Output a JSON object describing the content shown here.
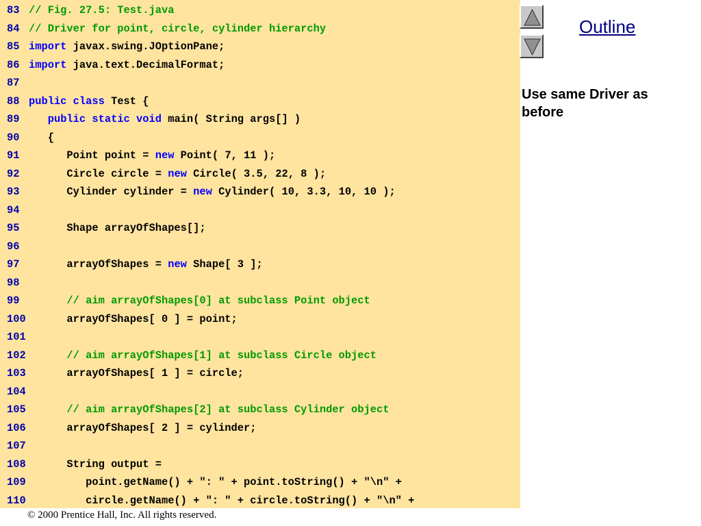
{
  "code_lines": [
    {
      "num": "83",
      "segs": [
        {
          "t": "// Fig. 27.5: Test.java",
          "k": "comment"
        }
      ]
    },
    {
      "num": "84",
      "segs": [
        {
          "t": "// Driver for point, circle, cylinder hierarchy",
          "k": "comment"
        }
      ]
    },
    {
      "num": "85",
      "segs": [
        {
          "t": "import",
          "k": "keyword"
        },
        {
          "t": " javax.swing.JOptionPane;",
          "k": "text"
        }
      ]
    },
    {
      "num": "86",
      "segs": [
        {
          "t": "import",
          "k": "keyword"
        },
        {
          "t": " java.text.DecimalFormat;",
          "k": "text"
        }
      ]
    },
    {
      "num": "87",
      "segs": []
    },
    {
      "num": "88",
      "segs": [
        {
          "t": "public class",
          "k": "keyword"
        },
        {
          "t": " Test {",
          "k": "text"
        }
      ]
    },
    {
      "num": "89",
      "segs": [
        {
          "t": "   ",
          "k": "text"
        },
        {
          "t": "public static void",
          "k": "keyword"
        },
        {
          "t": " main( String args[] )",
          "k": "text"
        }
      ]
    },
    {
      "num": "90",
      "segs": [
        {
          "t": "   {",
          "k": "text"
        }
      ]
    },
    {
      "num": "91",
      "segs": [
        {
          "t": "      Point point = ",
          "k": "text"
        },
        {
          "t": "new",
          "k": "keyword"
        },
        {
          "t": " Point( 7, 11 );",
          "k": "text"
        }
      ]
    },
    {
      "num": "92",
      "segs": [
        {
          "t": "      Circle circle = ",
          "k": "text"
        },
        {
          "t": "new",
          "k": "keyword"
        },
        {
          "t": " Circle( 3.5, 22, 8 );",
          "k": "text"
        }
      ]
    },
    {
      "num": "93",
      "segs": [
        {
          "t": "      Cylinder cylinder = ",
          "k": "text"
        },
        {
          "t": "new",
          "k": "keyword"
        },
        {
          "t": " Cylinder( 10, 3.3, 10, 10 );",
          "k": "text"
        }
      ]
    },
    {
      "num": "94",
      "segs": []
    },
    {
      "num": "95",
      "segs": [
        {
          "t": "      Shape arrayOfShapes[];",
          "k": "text"
        }
      ]
    },
    {
      "num": "96",
      "segs": []
    },
    {
      "num": "97",
      "segs": [
        {
          "t": "      arrayOfShapes = ",
          "k": "text"
        },
        {
          "t": "new",
          "k": "keyword"
        },
        {
          "t": " Shape[ 3 ];",
          "k": "text"
        }
      ]
    },
    {
      "num": "98",
      "segs": []
    },
    {
      "num": "99",
      "segs": [
        {
          "t": "      // aim arrayOfShapes[0] at subclass Point object",
          "k": "comment"
        }
      ]
    },
    {
      "num": "100",
      "segs": [
        {
          "t": "      arrayOfShapes[ 0 ] = point;",
          "k": "text"
        }
      ]
    },
    {
      "num": "101",
      "segs": []
    },
    {
      "num": "102",
      "segs": [
        {
          "t": "      // aim arrayOfShapes[1] at subclass Circle object",
          "k": "comment"
        }
      ]
    },
    {
      "num": "103",
      "segs": [
        {
          "t": "      arrayOfShapes[ 1 ] = circle;",
          "k": "text"
        }
      ]
    },
    {
      "num": "104",
      "segs": []
    },
    {
      "num": "105",
      "segs": [
        {
          "t": "      // aim arrayOfShapes[2] at subclass Cylinder object",
          "k": "comment"
        }
      ]
    },
    {
      "num": "106",
      "segs": [
        {
          "t": "      arrayOfShapes[ 2 ] = cylinder;",
          "k": "text"
        }
      ]
    },
    {
      "num": "107",
      "segs": []
    },
    {
      "num": "108",
      "segs": [
        {
          "t": "      String output =",
          "k": "text"
        }
      ]
    },
    {
      "num": "109",
      "segs": [
        {
          "t": "         point.getName() + \": \" + point.toString() + \"\\n\" +",
          "k": "text"
        }
      ]
    },
    {
      "num": "110",
      "segs": [
        {
          "t": "         circle.getName() + \": \" + circle.toString() + \"\\n\" +",
          "k": "text"
        }
      ]
    }
  ],
  "sidebar": {
    "outline_label": "Outline",
    "up_icon": "triangle-up-icon",
    "down_icon": "triangle-down-icon",
    "note": "Use same Driver as before"
  },
  "footer": {
    "copyright": "© 2000 Prentice Hall, Inc.  All rights reserved."
  },
  "colors": {
    "code_background": "#ffe4a0",
    "keyword": "#0000ff",
    "comment": "#009900",
    "line_number": "#0000aa",
    "outline_link": "#000080"
  }
}
